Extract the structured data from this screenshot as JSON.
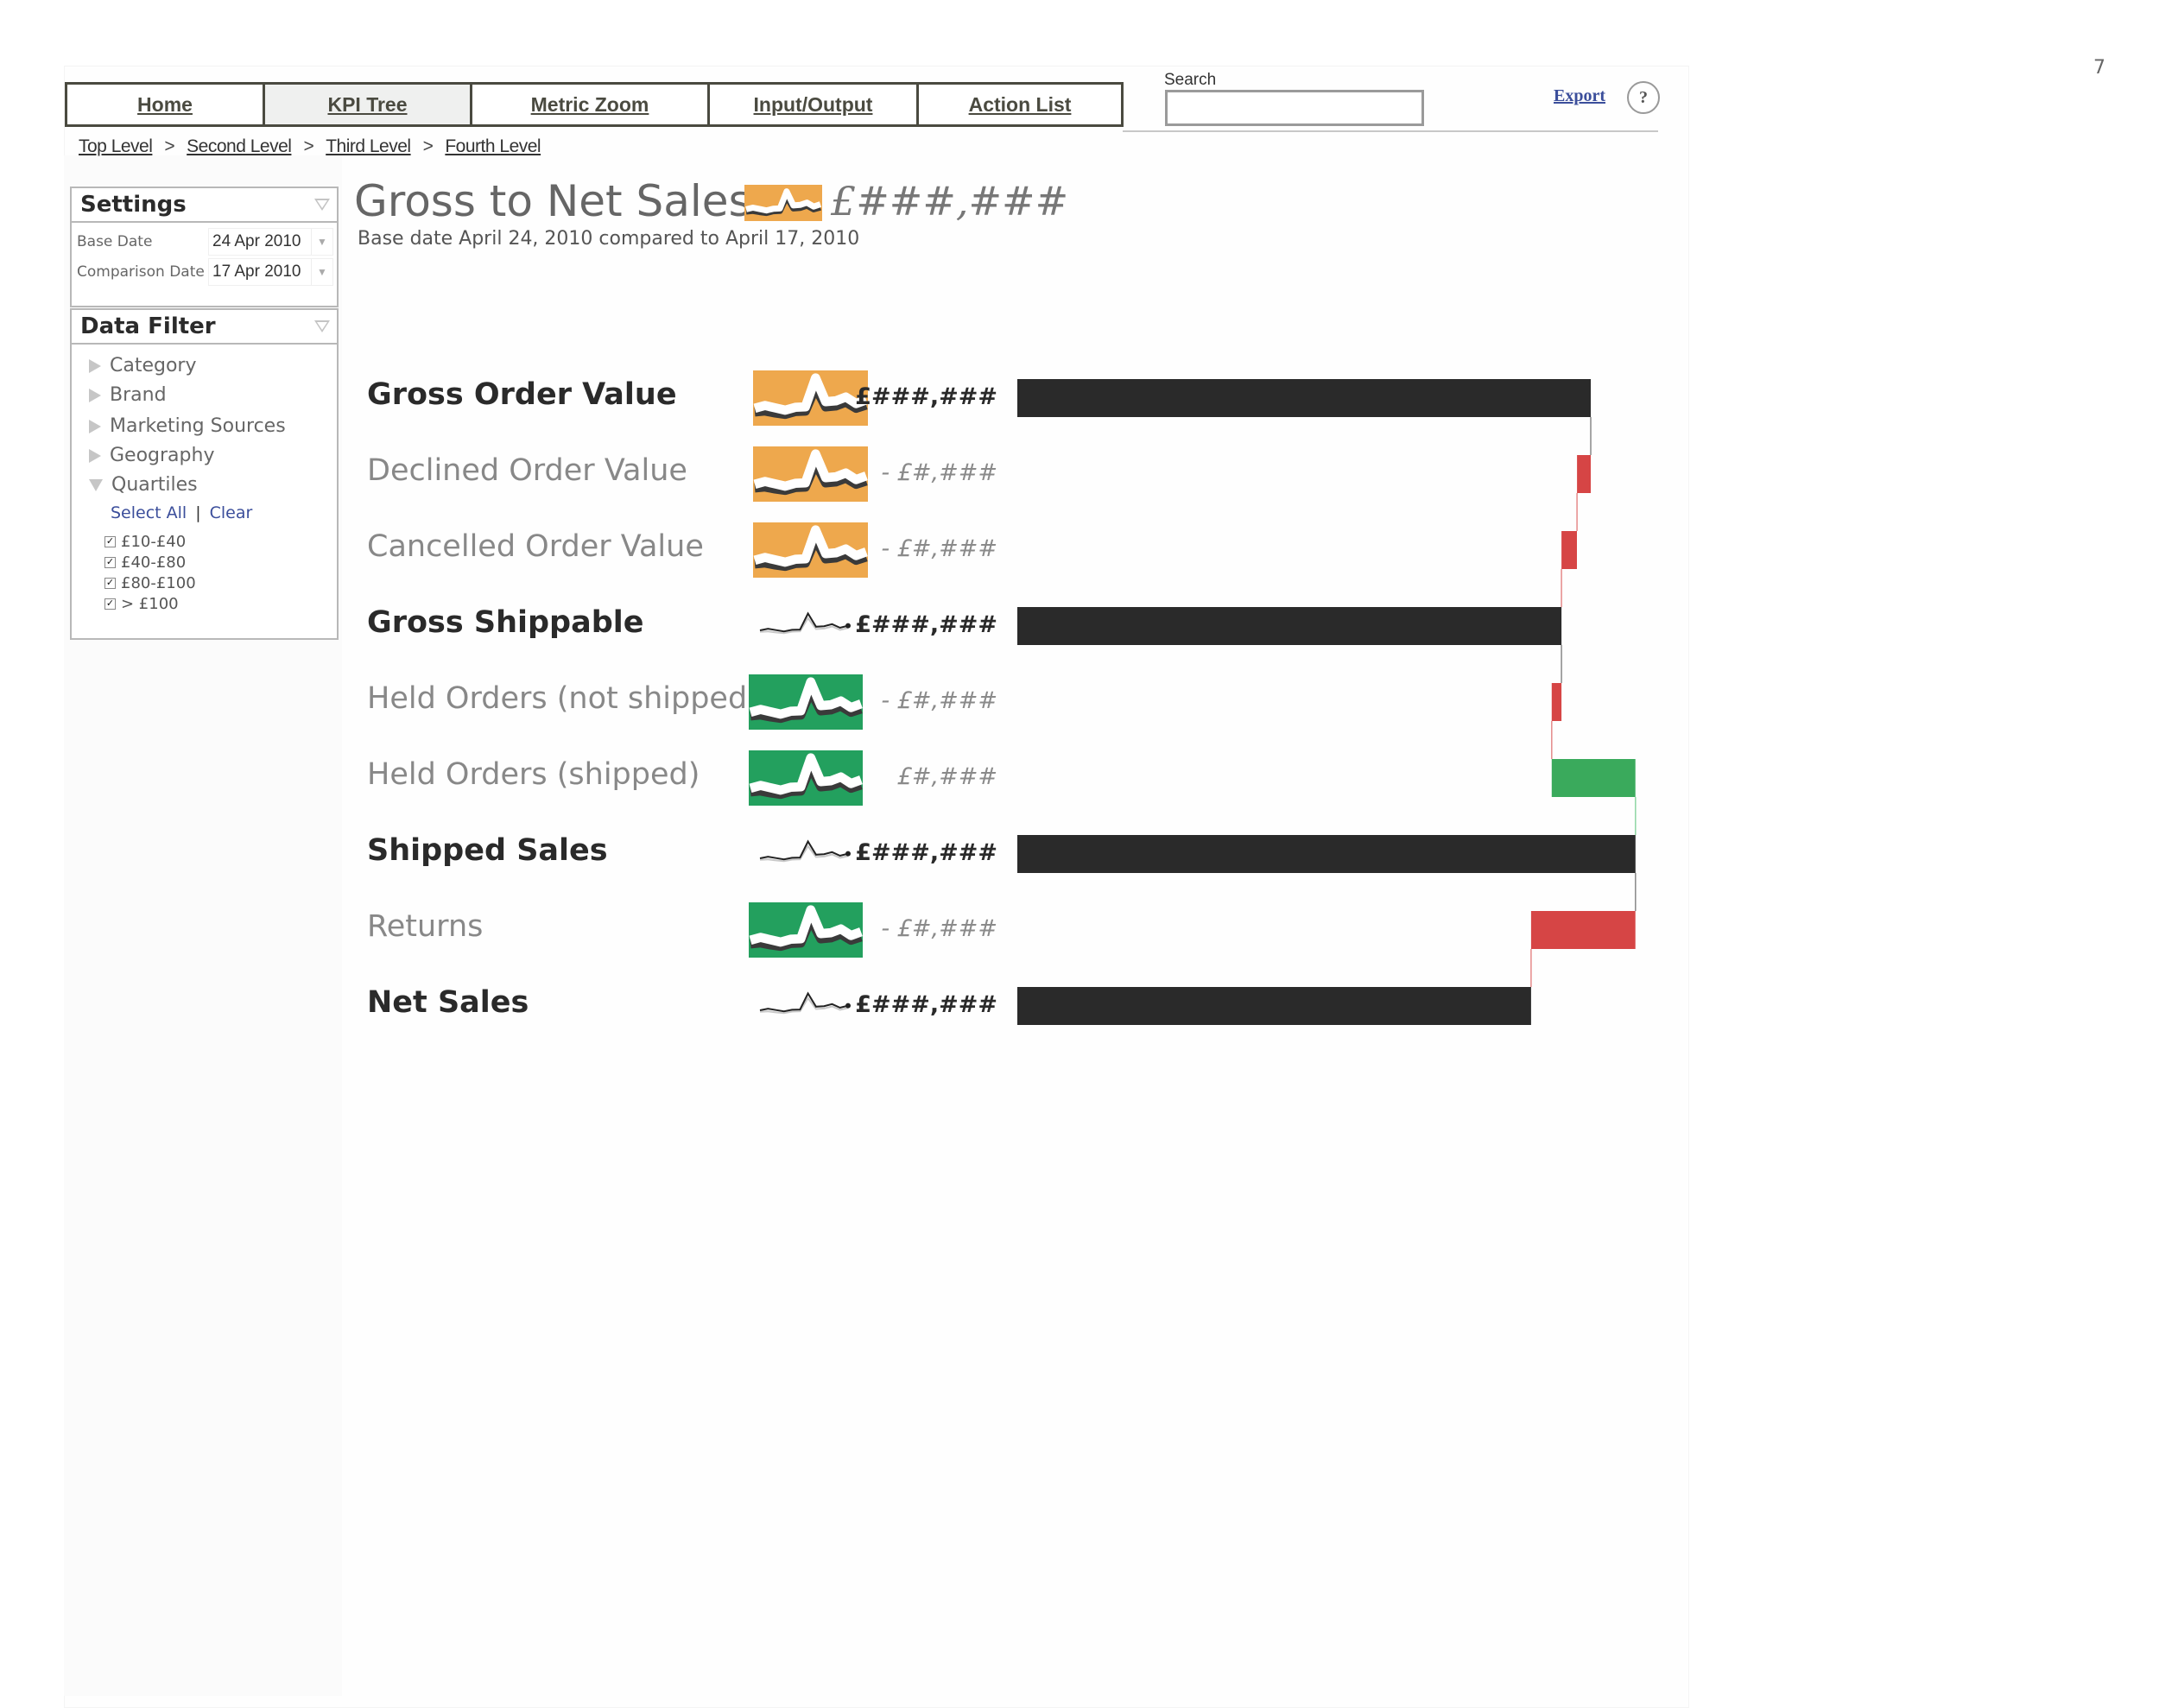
{
  "page_number": "7",
  "nav": {
    "tabs": [
      {
        "label": "Home",
        "active": false
      },
      {
        "label": "KPI Tree",
        "active": true
      },
      {
        "label": "Metric Zoom",
        "active": false
      },
      {
        "label": "Input/Output",
        "active": false
      },
      {
        "label": "Action List",
        "active": false
      }
    ],
    "search_label": "Search",
    "search_value": "",
    "export_label": "Export",
    "help_label": "?"
  },
  "breadcrumb": [
    "Top Level",
    "Second Level",
    "Third Level",
    "Fourth Level"
  ],
  "breadcrumb_separator": ">",
  "settings": {
    "title": "Settings",
    "base_date_label": "Base Date",
    "base_date_value": "24 Apr 2010",
    "comparison_date_label": "Comparison Date",
    "comparison_date_value": "17 Apr 2010"
  },
  "data_filter": {
    "title": "Data Filter",
    "items": [
      {
        "label": "Category",
        "expanded": false
      },
      {
        "label": "Brand",
        "expanded": false
      },
      {
        "label": "Marketing Sources",
        "expanded": false
      },
      {
        "label": "Geography",
        "expanded": false
      },
      {
        "label": "Quartiles",
        "expanded": true
      }
    ],
    "select_all_label": "Select All",
    "clear_label": "Clear",
    "quartiles": [
      {
        "label": "£10-£40",
        "checked": true
      },
      {
        "label": "£40-£80",
        "checked": true
      },
      {
        "label": "£80-£100",
        "checked": true
      },
      {
        "label": "> £100",
        "checked": true
      }
    ]
  },
  "main": {
    "title": "Gross to Net Sales",
    "title_value": "£###,###",
    "title_sparkline": "orange",
    "subtitle": "Base date  April 24, 2010 compared to April 17, 2010"
  },
  "colors": {
    "total_bar": "#2a2a2a",
    "decrease": "#d64545",
    "increase": "#3aaa5c",
    "spark_orange": "#eea84d",
    "spark_green": "#23a05e"
  },
  "chart_data": {
    "type": "bar",
    "subtype": "waterfall",
    "title": "Gross to Net Sales",
    "units": "relative (Gross Order Value = 100, estimated from bar lengths)",
    "categories": [
      "Gross Order Value",
      "Declined Order Value",
      "Cancelled Order Value",
      "Gross Shippable",
      "Held Orders (not shipped)",
      "Held Orders (shipped)",
      "Shipped Sales",
      "Returns",
      "Net Sales"
    ],
    "rows": [
      {
        "label": "Gross Order Value",
        "kind": "total",
        "value": 100.0,
        "display": "£###,###",
        "sparkline": "orange"
      },
      {
        "label": "Declined Order Value",
        "kind": "change",
        "value": -2.4,
        "display": "- £#,###",
        "sparkline": "orange"
      },
      {
        "label": "Cancelled Order Value",
        "kind": "change",
        "value": -2.7,
        "display": "- £#,###",
        "sparkline": "orange"
      },
      {
        "label": "Gross Shippable",
        "kind": "total",
        "value": 94.9,
        "display": "£###,###",
        "sparkline": "plain"
      },
      {
        "label": "Held Orders (not shipped)",
        "kind": "change",
        "value": -1.7,
        "display": "- £#,###",
        "sparkline": "green"
      },
      {
        "label": "Held Orders (shipped)",
        "kind": "change",
        "value": 14.6,
        "display": "£#,###",
        "sparkline": "green"
      },
      {
        "label": "Shipped Sales",
        "kind": "total",
        "value": 107.8,
        "display": "£###,###",
        "sparkline": "plain"
      },
      {
        "label": "Returns",
        "kind": "change",
        "value": -18.2,
        "display": "- £#,###",
        "sparkline": "green"
      },
      {
        "label": "Net Sales",
        "kind": "total",
        "value": 89.6,
        "display": "£###,###",
        "sparkline": "plain"
      }
    ],
    "sparkline_series": {
      "current": [
        3,
        3.6,
        3.1,
        2.6,
        3.2,
        3.3,
        9.5,
        4.4,
        4.6,
        5.4,
        4.0,
        4.8
      ],
      "previous": [
        2.2,
        2.4,
        2.0,
        1.7,
        2.3,
        2.4,
        7.5,
        3.3,
        3.5,
        4.3,
        3.0,
        3.7
      ]
    },
    "xlabel": "",
    "ylabel": "",
    "grid": false,
    "legend": "none"
  }
}
